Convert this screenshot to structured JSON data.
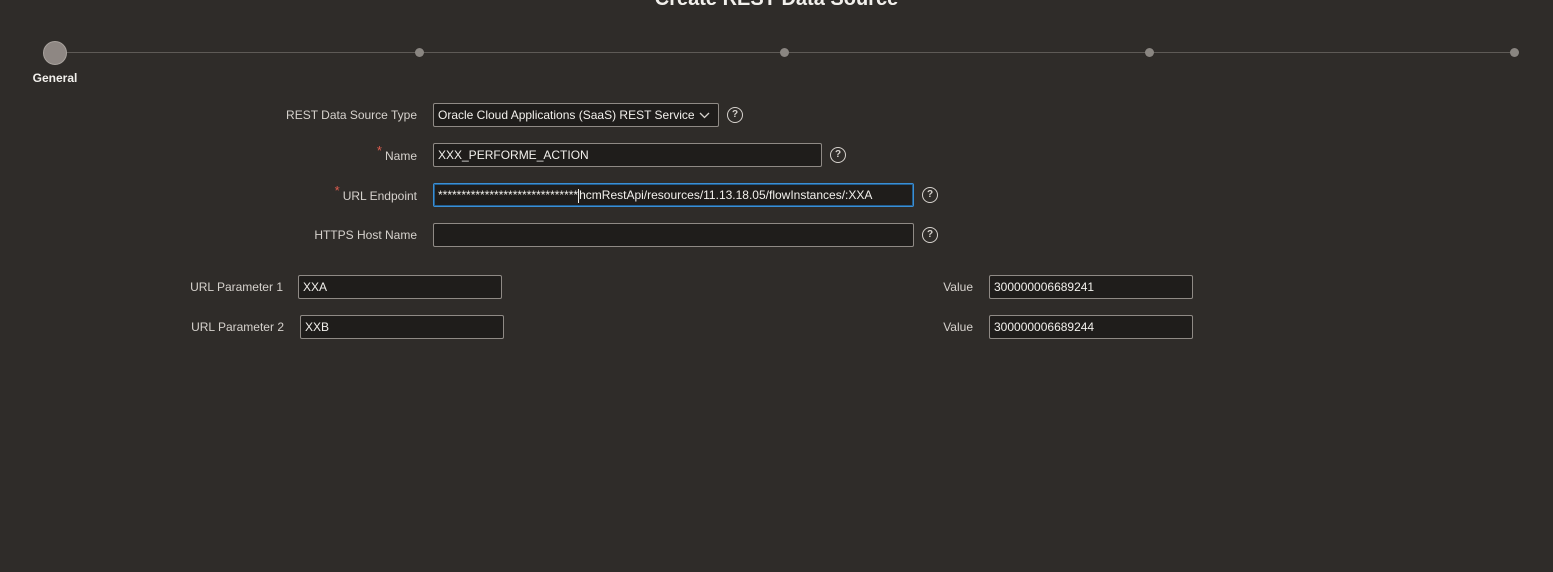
{
  "page": {
    "title": "Create REST Data Source"
  },
  "train": {
    "steps": [
      {
        "label": "General",
        "current": true
      },
      {
        "label": "",
        "current": false
      },
      {
        "label": "",
        "current": false
      },
      {
        "label": "",
        "current": false
      },
      {
        "label": "",
        "current": false
      }
    ]
  },
  "form": {
    "rest_type": {
      "label": "REST Data Source Type",
      "value": "Oracle Cloud Applications (SaaS) REST Service",
      "chevron_icon": "chevron-down-icon"
    },
    "name": {
      "label": "Name",
      "required_marker": "*",
      "value": "XXX_PERFORME_ACTION"
    },
    "url_endpoint": {
      "label": "URL Endpoint",
      "required_marker": "*",
      "value_masked": "******************************",
      "value_rest": "hcmRestApi/resources/11.13.18.05/flowInstances/:XXA"
    },
    "https_host": {
      "label": "HTTPS Host Name",
      "value": ""
    },
    "help_glyph": "?",
    "url_params": [
      {
        "label": "URL Parameter 1",
        "name": "XXA",
        "value_label": "Value",
        "value": "300000006689241"
      },
      {
        "label": "URL Parameter 2",
        "name": "XXB",
        "value_label": "Value",
        "value": "300000006689244"
      }
    ]
  },
  "icons": {
    "help": "help-circle-icon",
    "chevron": "chevron-down-icon"
  },
  "colors": {
    "background": "#2f2c29",
    "focus": "#3a8fd6",
    "required": "#e05d4f"
  }
}
